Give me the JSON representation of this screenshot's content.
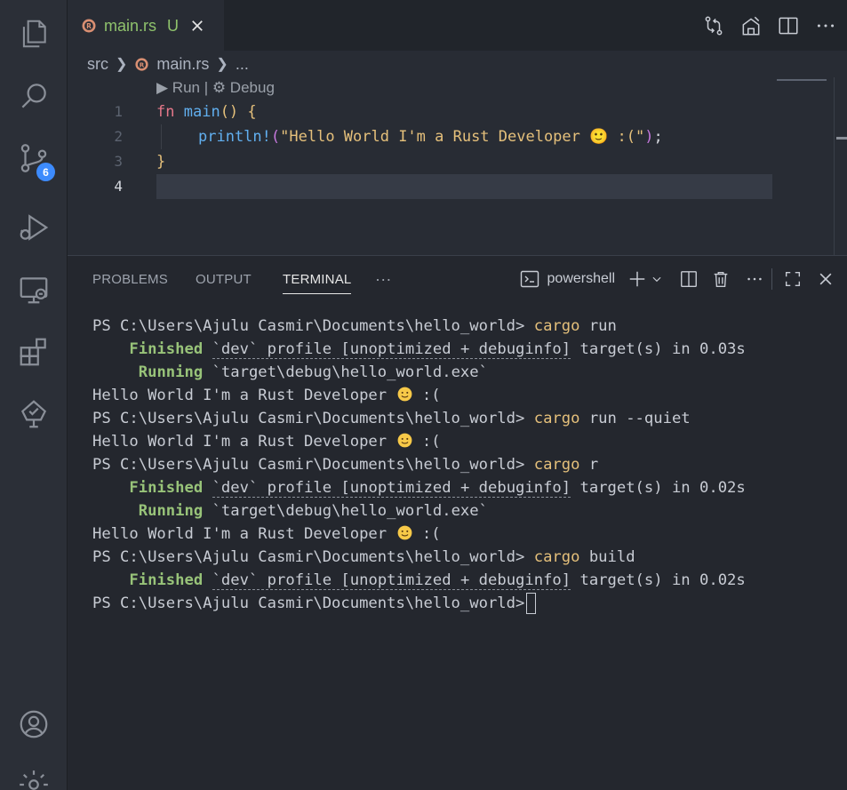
{
  "activity_bar": {
    "items": [
      {
        "name": "explorer-icon"
      },
      {
        "name": "search-icon"
      },
      {
        "name": "source-control-icon",
        "badge": "6"
      },
      {
        "name": "run-debug-icon"
      },
      {
        "name": "remote-explorer-icon"
      },
      {
        "name": "extensions-icon"
      },
      {
        "name": "testing-icon"
      }
    ],
    "bottom": [
      {
        "name": "accounts-icon"
      },
      {
        "name": "manage-gear-icon"
      }
    ]
  },
  "tab": {
    "filename": "main.rs",
    "status": "U"
  },
  "breadcrumb": {
    "folder": "src",
    "file": "main.rs",
    "more": "..."
  },
  "editor": {
    "codelens": "▶ Run | ⚙ Debug",
    "lines": [
      {
        "n": "1"
      },
      {
        "n": "2"
      },
      {
        "n": "3"
      },
      {
        "n": "4"
      }
    ],
    "code": {
      "l1_kw": "fn",
      "l1_fn": "main",
      "l1_rest": "() {",
      "l2_macro": "println!",
      "l2_str": "\"Hello World I'm a Rust Developer 🙂 :(\"",
      "l2_end": ";",
      "l3": "}"
    }
  },
  "panel": {
    "tabs": [
      "PROBLEMS",
      "OUTPUT",
      "TERMINAL"
    ],
    "more": "···",
    "shell": "powershell",
    "active_tab": "TERMINAL"
  },
  "terminal": {
    "prompt": "PS C:\\Users\\Ajulu Casmir\\Documents\\hello_world>",
    "cmd1": "cargo",
    "cmd1_args": " run",
    "finished_label": "Finished",
    "finished_mid": "`dev` profile [unoptimized + debuginfo]",
    "finished_end_1": " target(s) in 0.03s",
    "running_label": "Running",
    "running_path": "`target\\debug\\hello_world.exe`",
    "output": "Hello World I'm a Rust Developer",
    "output_tail": " :(",
    "cmd2": "cargo",
    "cmd2_args": " run --quiet",
    "cmd3": "cargo",
    "cmd3_args": " r",
    "finished_end_2": " target(s) in 0.02s",
    "cmd4": "cargo",
    "cmd4_args": " build",
    "finished_end_3": " target(s) in 0.02s"
  },
  "colors": {
    "accent_green": "#8fc26c",
    "badge_blue": "#3d8bfd",
    "command_yellow": "#e5c07b",
    "finished_green": "#98c379"
  }
}
